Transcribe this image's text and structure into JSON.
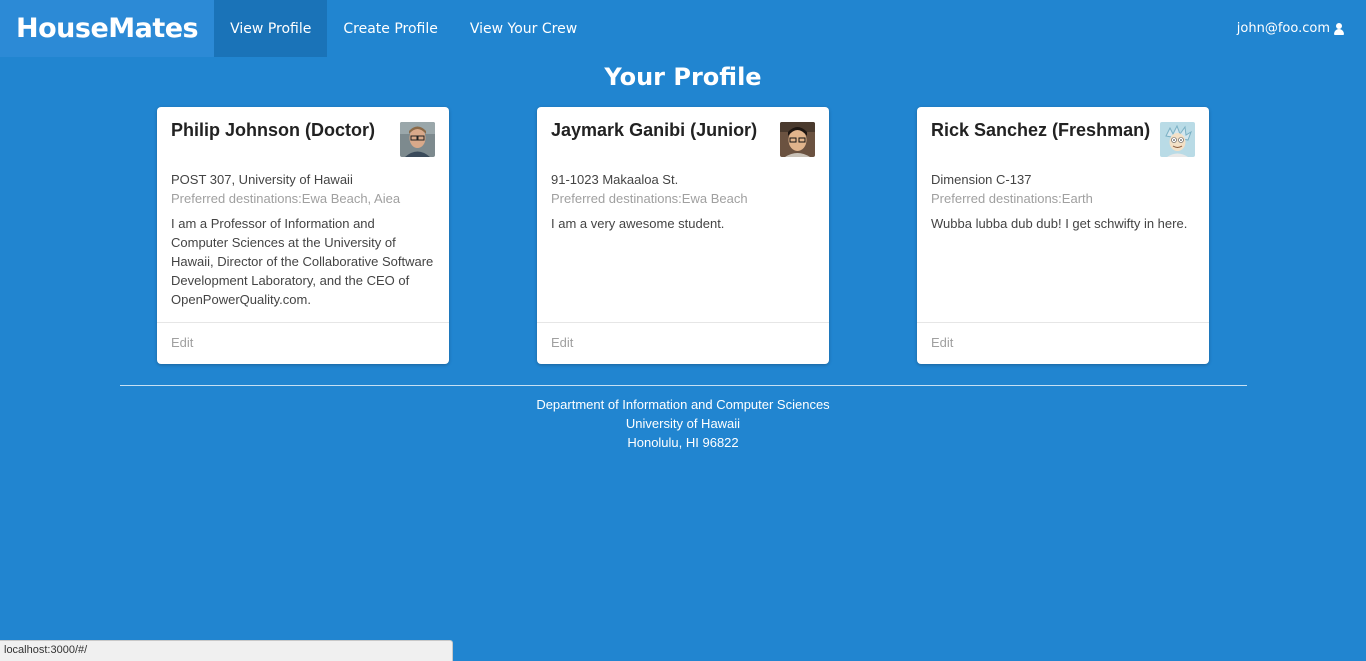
{
  "menu": {
    "brand": "HouseMates",
    "items": [
      {
        "label": "View Profile",
        "active": true
      },
      {
        "label": "Create Profile",
        "active": false
      },
      {
        "label": "View Your Crew",
        "active": false
      }
    ],
    "user": "john@foo.com",
    "user_icon": "user-icon"
  },
  "page": {
    "title": "Your Profile"
  },
  "cards": [
    {
      "name": "Philip Johnson (Doctor)",
      "address": "POST 307, University of Hawaii",
      "destinations": "Preferred destinations:Ewa Beach, Aiea",
      "description": "I am a Professor of Information and Computer Sciences at the University of Hawaii, Director of the Collaborative Software Development Laboratory, and the CEO of OpenPowerQuality.com.",
      "edit_label": "Edit"
    },
    {
      "name": "Jaymark Ganibi (Junior)",
      "address": "91-1023 Makaaloa St.",
      "destinations": "Preferred destinations:Ewa Beach",
      "description": "I am a very awesome student.",
      "edit_label": "Edit"
    },
    {
      "name": "Rick Sanchez (Freshman)",
      "address": "Dimension C-137",
      "destinations": "Preferred destinations:Earth",
      "description": "Wubba lubba dub dub! I get schwifty in here.",
      "edit_label": "Edit"
    }
  ],
  "footer": {
    "line1": "Department of Information and Computer Sciences",
    "line2": "University of Hawaii",
    "line3": "Honolulu, HI 96822"
  },
  "status_bar": {
    "url": "localhost:3000/#/"
  },
  "colors": {
    "background": "#2185d0",
    "active_nav": "#1a73b8",
    "card": "#ffffff"
  }
}
